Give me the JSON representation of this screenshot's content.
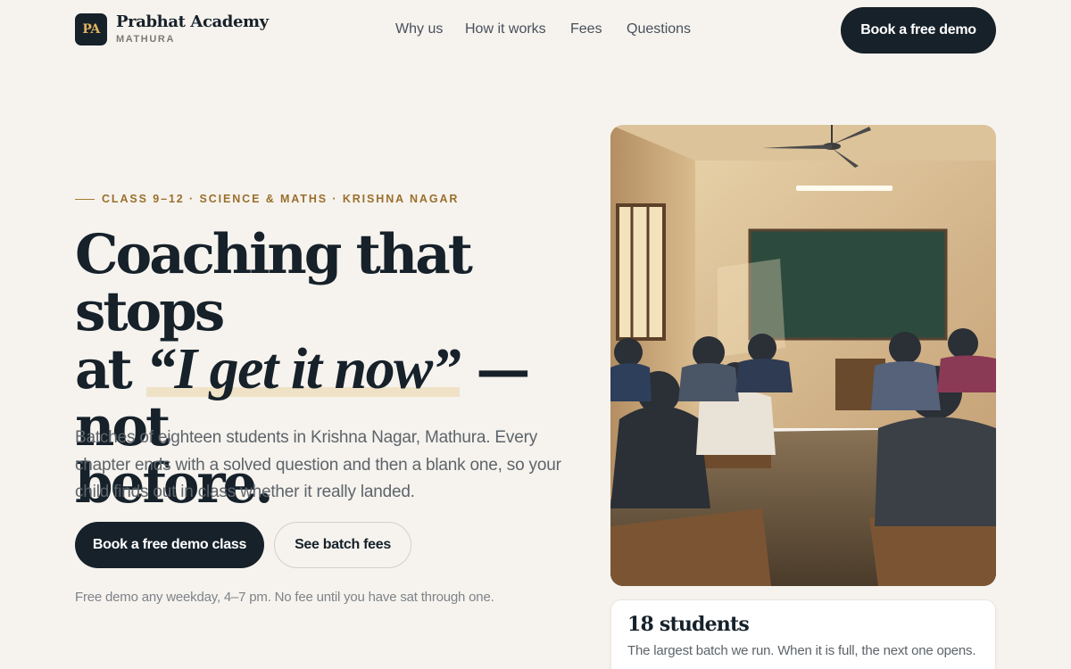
{
  "header": {
    "logo_initials": "PA",
    "brand_name": "Prabhat Academy",
    "brand_location": "MATHURA",
    "nav": [
      {
        "label": "Why us"
      },
      {
        "label": "How it works"
      },
      {
        "label": "Fees"
      },
      {
        "label": "Questions"
      }
    ],
    "cta_label": "Book a free demo"
  },
  "hero": {
    "eyebrow": "CLASS 9–12 · SCIENCE & MATHS · KRISHNA NAGAR",
    "headline_line1": "Coaching that stops",
    "headline_at": "at ",
    "headline_emphasis": "“I get it now”",
    "headline_rest": " — not",
    "headline_line3": "before.",
    "lede": "Batches of eighteen students in Krishna Nagar, Mathura. Every chapter ends with a solved question and then a blank one, so your child finds out in class whether it really landed.",
    "primary_cta": "Book a free demo class",
    "secondary_cta": "See batch fees",
    "fine_print": "Free demo any weekday, 4–7 pm. No fee until you have sat through one."
  },
  "stat": {
    "value": "18 students",
    "caption": "The largest batch we run. When it is full, the next one opens."
  },
  "colors": {
    "background": "#f6f3ee",
    "ink": "#16212a",
    "accent": "#9a6f2c",
    "highlight": "#efe2c6"
  }
}
